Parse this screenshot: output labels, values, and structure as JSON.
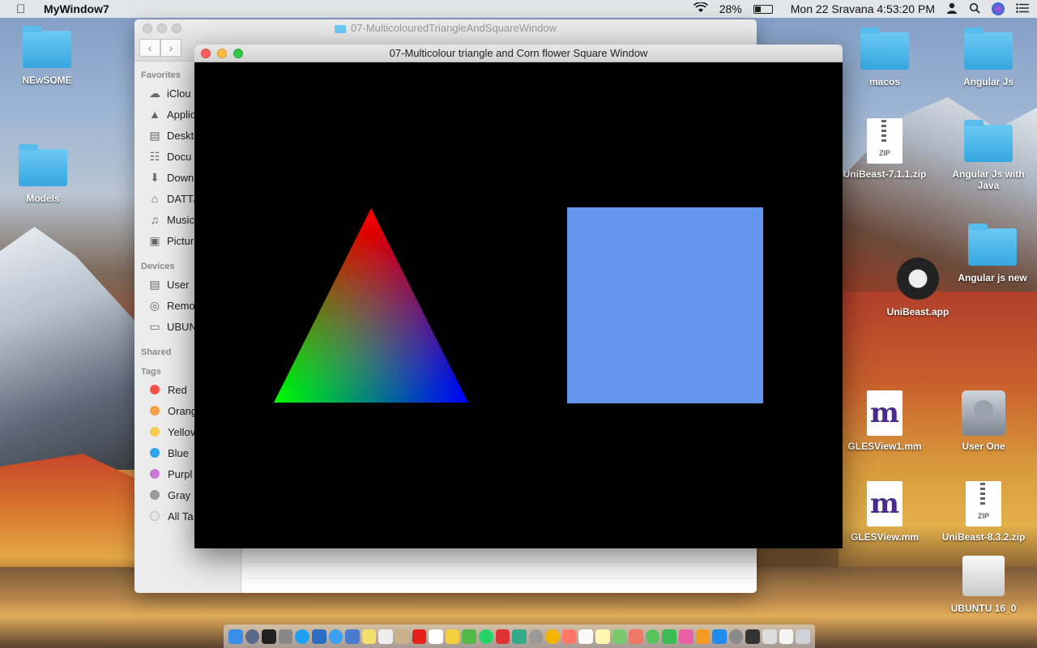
{
  "menubar": {
    "app_name": "MyWindow7",
    "battery": "28%",
    "datetime": "Mon 22 Sravana  4:53:20 PM"
  },
  "desktop": {
    "left_icons": [
      "NEwSOME",
      "Models"
    ],
    "right_icons": [
      "macos",
      "Angular Js",
      "UniBeast-7.1.1.zip",
      "Angular Js with Java",
      "UniBeast.app",
      "Angular js new",
      "GLESView1.mm",
      "User One",
      "GLESView.mm",
      "UniBeast-8.3.2.zip",
      "UBUNTU 16_0"
    ],
    "zip_label": "ZIP"
  },
  "finder": {
    "title": "07-MulticolouredTriangleAndSquareWindow",
    "sections": {
      "favorites": "Favorites",
      "devices": "Devices",
      "shared": "Shared",
      "tags": "Tags"
    },
    "favorites": [
      {
        "label": "iClou",
        "icon": "cloud-icon"
      },
      {
        "label": "Applic",
        "icon": "applications-icon"
      },
      {
        "label": "Deskt",
        "icon": "desktop-icon"
      },
      {
        "label": "Docu",
        "icon": "documents-icon"
      },
      {
        "label": "Down",
        "icon": "downloads-icon"
      },
      {
        "label": "DATT/",
        "icon": "home-icon"
      },
      {
        "label": "Music",
        "icon": "music-icon"
      },
      {
        "label": "Pictur",
        "icon": "pictures-icon"
      }
    ],
    "devices": [
      {
        "label": "User",
        "icon": "drive-icon"
      },
      {
        "label": "Remo",
        "icon": "disc-icon"
      },
      {
        "label": "UBUN",
        "icon": "external-drive-icon"
      }
    ],
    "tags": [
      {
        "label": "Red",
        "color": "#f5524a"
      },
      {
        "label": "Orang",
        "color": "#f5a046"
      },
      {
        "label": "Yellov",
        "color": "#f7cb4d"
      },
      {
        "label": "Blue",
        "color": "#2fa3f0"
      },
      {
        "label": "Purpl",
        "color": "#c978d6"
      },
      {
        "label": "Gray",
        "color": "#9a9a9a"
      },
      {
        "label": "All Ta",
        "color": "#e6e6e6"
      }
    ]
  },
  "glwindow": {
    "title": "07-Multicolour triangle and Corn flower Square Window",
    "triangle_colors": {
      "top": "#ff0000",
      "left": "#00ff00",
      "right": "#0000ff"
    },
    "square_color": "#6495ed",
    "background": "#000000"
  }
}
